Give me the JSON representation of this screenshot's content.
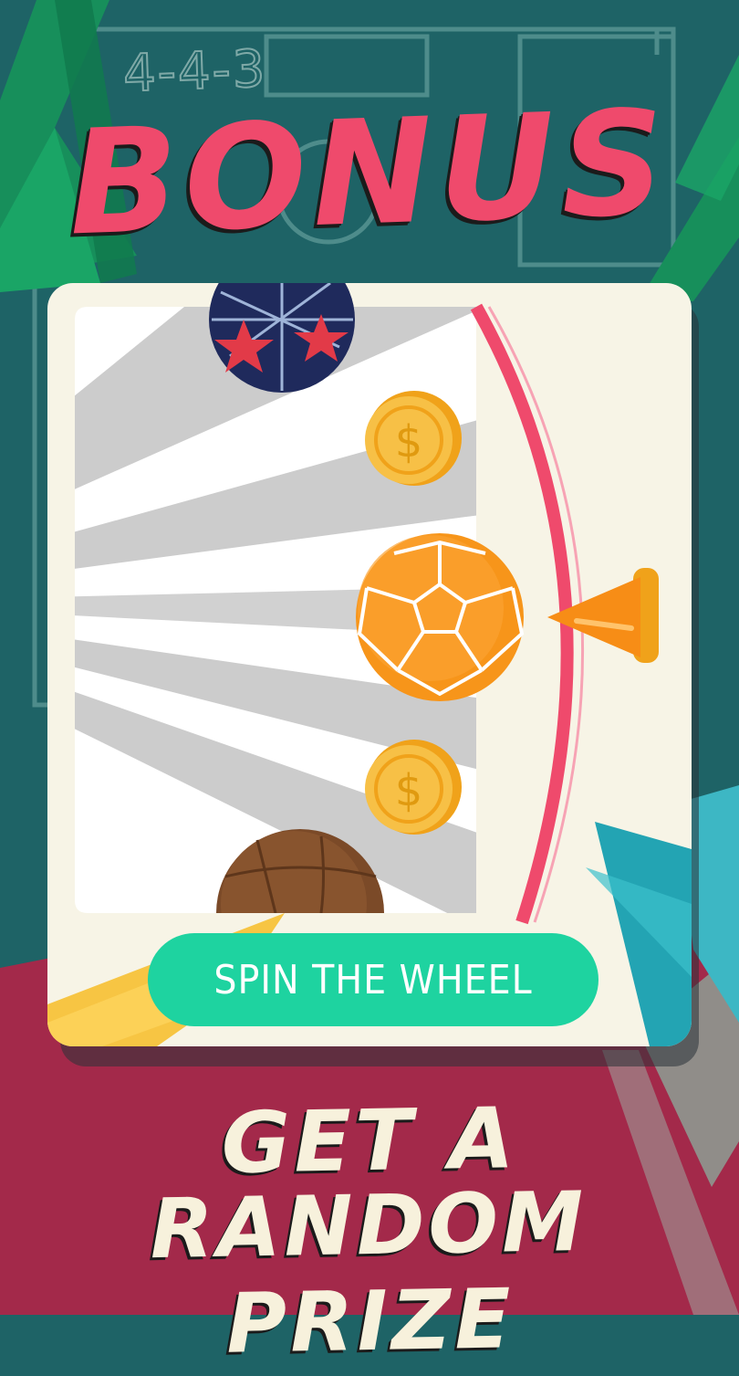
{
  "header": {
    "formation": "4-4-3",
    "title": "BONUS"
  },
  "wheel": {
    "prizes": [
      {
        "name": "stars-ball",
        "kind": "ball"
      },
      {
        "name": "coin",
        "kind": "coin",
        "symbol": "$"
      },
      {
        "name": "orange-ball",
        "kind": "ball"
      },
      {
        "name": "coin",
        "kind": "coin",
        "symbol": "$"
      },
      {
        "name": "leather-ball",
        "kind": "ball"
      }
    ],
    "pointer_icon": "cone-pointer-icon",
    "rim_color": "#ef4a6c",
    "coin_symbol": "$"
  },
  "spin_button": {
    "label": "SPIN THE WHEEL",
    "color": "#1ed3a0"
  },
  "tagline": {
    "line1": "GET A",
    "line2": "RANDOM PRIZE"
  },
  "colors": {
    "background_teal": "#1e6366",
    "background_crimson": "#a3294a",
    "title_pink": "#ef4a6c",
    "card_cream": "#f7f4e6"
  }
}
